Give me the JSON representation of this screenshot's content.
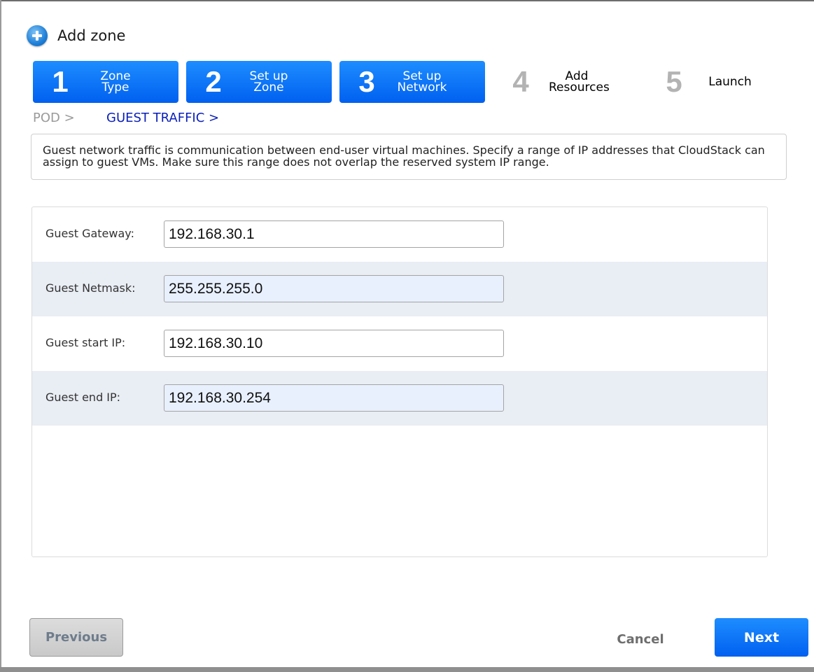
{
  "dialog": {
    "title": "Add zone",
    "icon": "add-circle-icon"
  },
  "steps": [
    {
      "number": "1",
      "line1": "Zone",
      "line2": "Type",
      "state": "completed"
    },
    {
      "number": "2",
      "line1": "Set up",
      "line2": "Zone",
      "state": "completed"
    },
    {
      "number": "3",
      "line1": "Set up",
      "line2": "Network",
      "state": "current"
    },
    {
      "number": "4",
      "line1": "Add",
      "line2": "Resources",
      "state": "pending"
    },
    {
      "number": "5",
      "line1": "Launch",
      "line2": "",
      "state": "pending"
    }
  ],
  "breadcrumb": {
    "pod": "POD >",
    "guest_traffic": "GUEST TRAFFIC >"
  },
  "description": "Guest network traffic is communication between end-user virtual machines. Specify a range of IP addresses that CloudStack can assign to guest VMs. Make sure this range does not overlap the reserved system IP range.",
  "form": {
    "fields": [
      {
        "label": "Guest Gateway:",
        "value": "192.168.30.1"
      },
      {
        "label": "Guest Netmask:",
        "value": "255.255.255.0"
      },
      {
        "label": "Guest start IP:",
        "value": "192.168.30.10"
      },
      {
        "label": "Guest end IP:",
        "value": "192.168.30.254"
      }
    ]
  },
  "buttons": {
    "previous": "Previous",
    "cancel": "Cancel",
    "next": "Next"
  },
  "colors": {
    "accent": "#0a73ff",
    "breadcrumb_active": "#0a1fb8",
    "row_shade": "#e9edf4"
  }
}
